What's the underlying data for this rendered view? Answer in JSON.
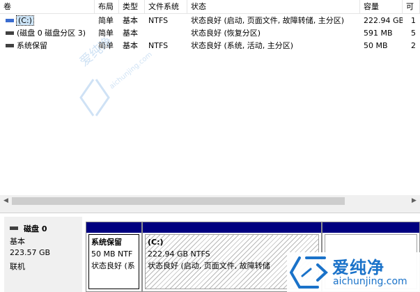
{
  "columns": [
    "卷",
    "布局",
    "类型",
    "文件系统",
    "状态",
    "容量",
    "可"
  ],
  "volumes": [
    {
      "name": "(C:)",
      "layout": "简单",
      "type": "基本",
      "fs": "NTFS",
      "status": "状态良好 (启动, 页面文件, 故障转储, 主分区)",
      "capacity": "222.94 GB",
      "extra": "1"
    },
    {
      "name": "(磁盘 0 磁盘分区 3)",
      "layout": "简单",
      "type": "基本",
      "fs": "",
      "status": "状态良好 (恢复分区)",
      "capacity": "591 MB",
      "extra": "5"
    },
    {
      "name": "系统保留",
      "layout": "简单",
      "type": "基本",
      "fs": "NTFS",
      "status": "状态良好 (系统, 活动, 主分区)",
      "capacity": "50 MB",
      "extra": "2"
    }
  ],
  "disk": {
    "name": "磁盘 0",
    "type": "基本",
    "size": "223.57 GB",
    "state": "联机"
  },
  "partitions": [
    {
      "title": "系统保留",
      "line1": "50 MB NTF",
      "line2": "状态良好 (系"
    },
    {
      "title": "(C:)",
      "line1": "222.94 GB NTFS",
      "line2": "状态良好 (启动, 页面文件, 故障转储"
    }
  ],
  "watermark": {
    "brand": "爱纯净",
    "url": "aichunjing.com"
  },
  "colors": {
    "partition_bar": "#000080",
    "selection": "#cce4f7",
    "watermark": "#1a72c9"
  }
}
